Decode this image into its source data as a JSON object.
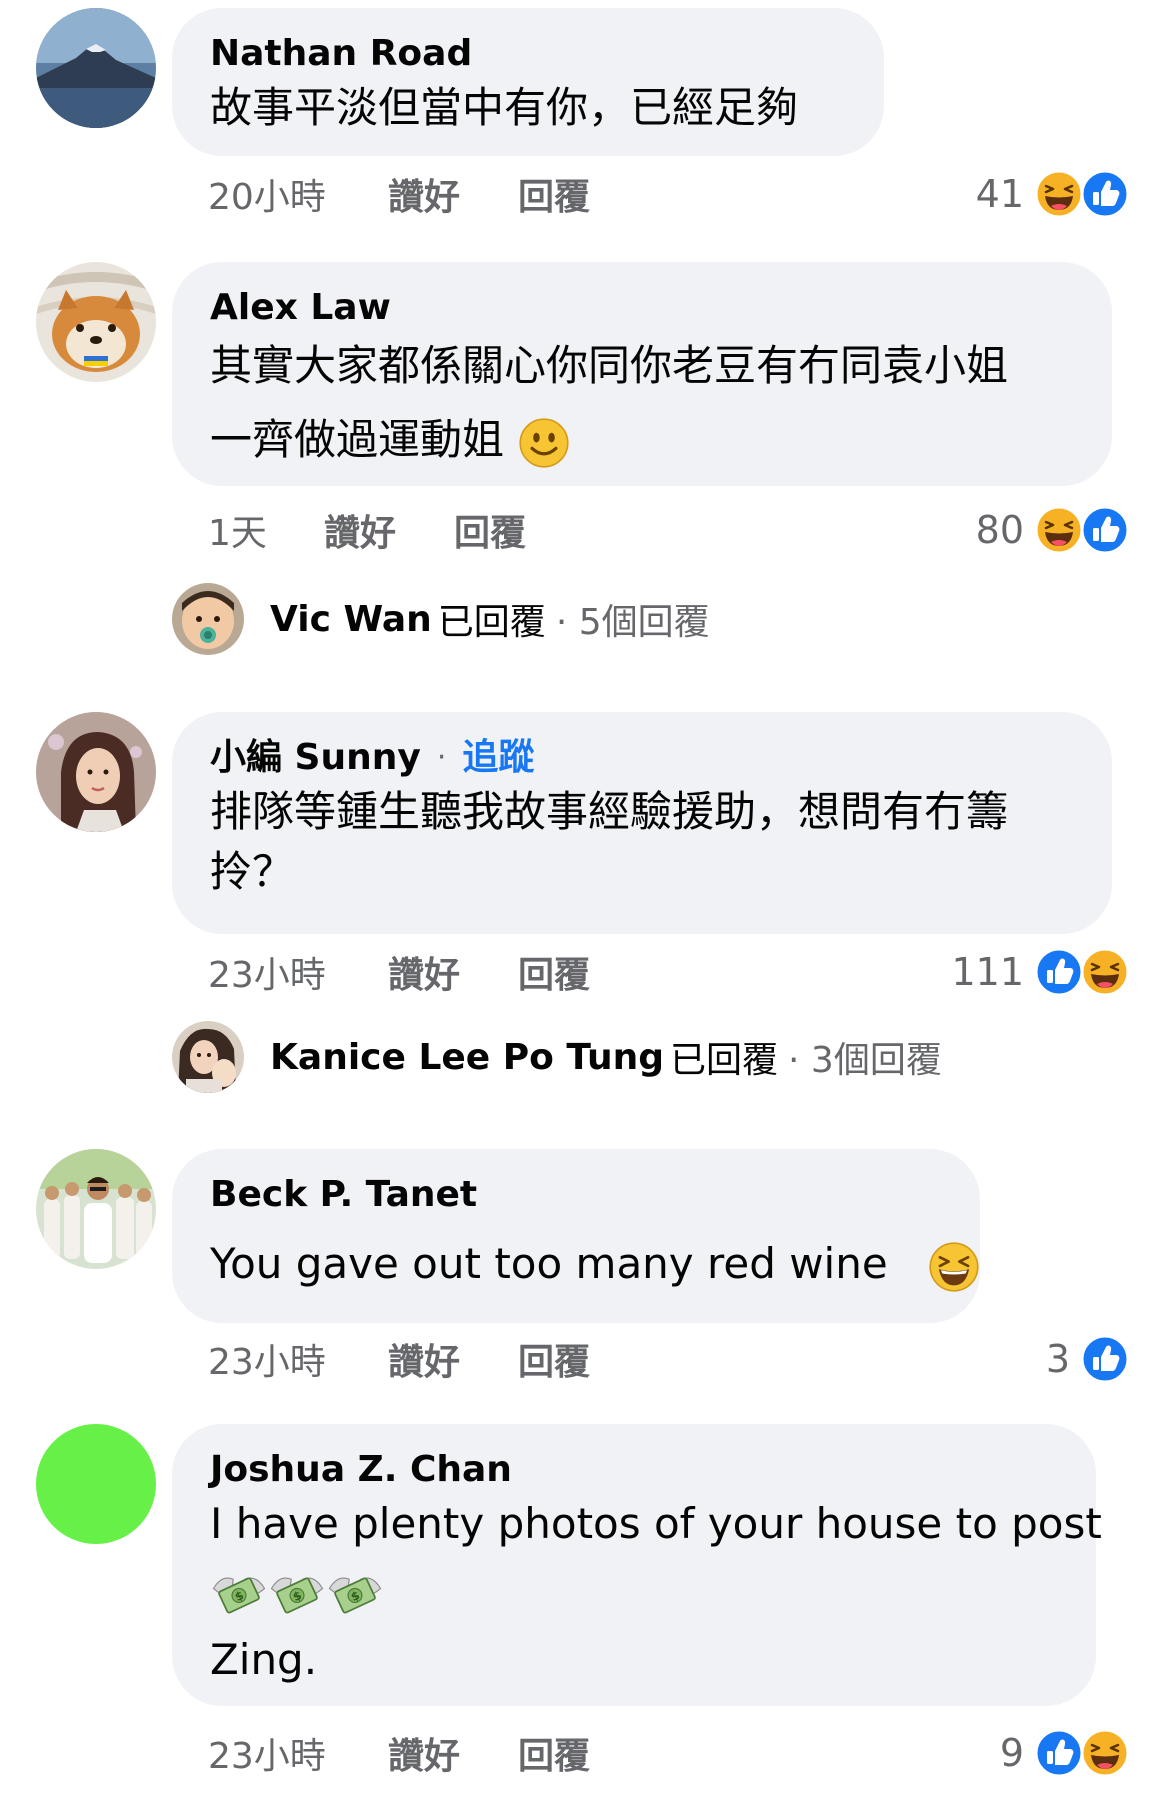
{
  "comments": [
    {
      "author": "Nathan Road",
      "lines": [
        "故事平淡但當中有你，已經足夠"
      ],
      "time": "20小時",
      "like_label": "讚好",
      "reply_label": "回覆",
      "reaction_count": "41",
      "reactions": [
        "haha",
        "like"
      ]
    },
    {
      "author": "Alex Law",
      "lines": [
        "其實大家都係關心你同你老豆有冇同袁小姐",
        "一齊做過運動姐"
      ],
      "time": "1天",
      "like_label": "讚好",
      "reply_label": "回覆",
      "reaction_count": "80",
      "reactions": [
        "haha",
        "like"
      ],
      "reply_summary": {
        "name": "Vic Wan",
        "action": "已回覆",
        "count": "· 5個回覆"
      }
    },
    {
      "author": "小編 Sunny",
      "separator": "·",
      "follow_label": "追蹤",
      "lines": [
        "排隊等鍾生聽我故事經驗援助，想問有冇籌",
        "拎？"
      ],
      "time": "23小時",
      "like_label": "讚好",
      "reply_label": "回覆",
      "reaction_count": "111",
      "reactions": [
        "like",
        "haha"
      ],
      "reply_summary": {
        "name": "Kanice Lee Po Tung",
        "action": "已回覆",
        "count": "· 3個回覆"
      }
    },
    {
      "author": "Beck P. Tanet",
      "lines": [
        "You gave out too many red wine"
      ],
      "time": "23小時",
      "like_label": "讚好",
      "reply_label": "回覆",
      "reaction_count": "3",
      "reactions": [
        "like"
      ]
    },
    {
      "author": "Joshua Z. Chan",
      "lines": [
        "I have plenty photos of your house to post",
        "Zing."
      ],
      "time": "23小時",
      "like_label": "讚好",
      "reply_label": "回覆",
      "reaction_count": "9",
      "reactions": [
        "like",
        "haha"
      ]
    }
  ],
  "icons": {
    "like": "like-reaction-icon",
    "haha": "haha-reaction-icon",
    "smile": "smile-emoji-icon",
    "laughing": "laughing-emoji-icon",
    "money": "money-with-wings-emoji-icon"
  },
  "colors": {
    "bubble": "#f0f2f5",
    "secondary_text": "#65676b",
    "link_blue": "#1877f2",
    "like_blue": "#1877f2",
    "haha_yellow": "#f7b125",
    "green_avatar": "#66f048"
  }
}
